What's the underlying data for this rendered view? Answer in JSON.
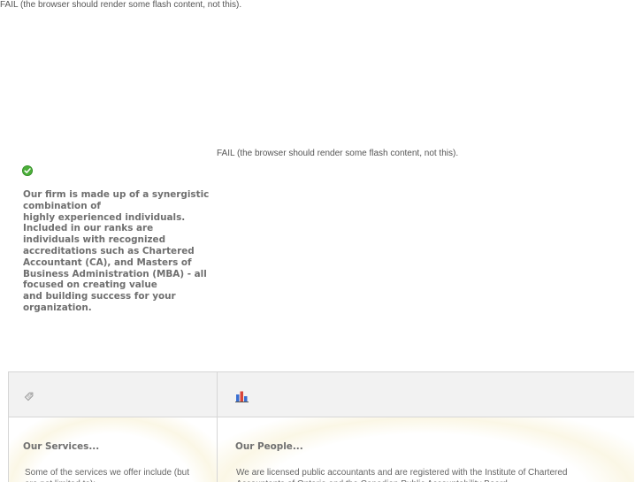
{
  "flash": {
    "fallback_top": "FAIL (the browser should render some flash content, not this).",
    "fallback_mid": "FAIL (the browser should render some flash content, not this)."
  },
  "intro": {
    "lines": [
      "Our firm is made up of a synergistic",
      "combination of",
      "highly experienced individuals.",
      "Included in our ranks are",
      "individuals with recognized",
      "accreditations such as Chartered",
      "Accountant (CA), and Masters of",
      "Business Administration (MBA) - all",
      "focused on creating value",
      "and building success for your",
      "organization."
    ]
  },
  "services": {
    "icon": "tag-icon",
    "title": "Our Services...",
    "text": "Some of the services we offer include (but are not limited to):"
  },
  "people": {
    "icon": "bar-chart-icon",
    "title": "Our People...",
    "text": "We are licensed public accountants and are registered with the Institute of Chartered Accountants of Ontario and the Canadian Public Accountability Board."
  },
  "colors": {
    "check_green": "#4caf3a",
    "panel_border": "#d6d6d6",
    "panel_header_bg": "#f2f2f2",
    "text_gray": "#6f6f6f"
  }
}
